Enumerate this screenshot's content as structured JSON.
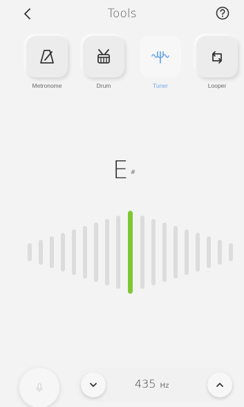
{
  "header": {
    "title": "Tools"
  },
  "tools": [
    {
      "label": "Metronome",
      "icon": "metronome-icon",
      "active": false
    },
    {
      "label": "Drum",
      "icon": "drum-icon",
      "active": false
    },
    {
      "label": "Tuner",
      "icon": "tuner-icon",
      "active": true
    },
    {
      "label": "Looper",
      "icon": "looper-icon",
      "active": false
    }
  ],
  "tuner": {
    "note": "E",
    "accidental": "#",
    "needle_color": "#7ec832",
    "bar_color": "#dcdcdc"
  },
  "pitch": {
    "value": "435",
    "unit": "Hz"
  },
  "colors": {
    "accent": "#6fa7e8",
    "background": "#f3f3f3"
  }
}
